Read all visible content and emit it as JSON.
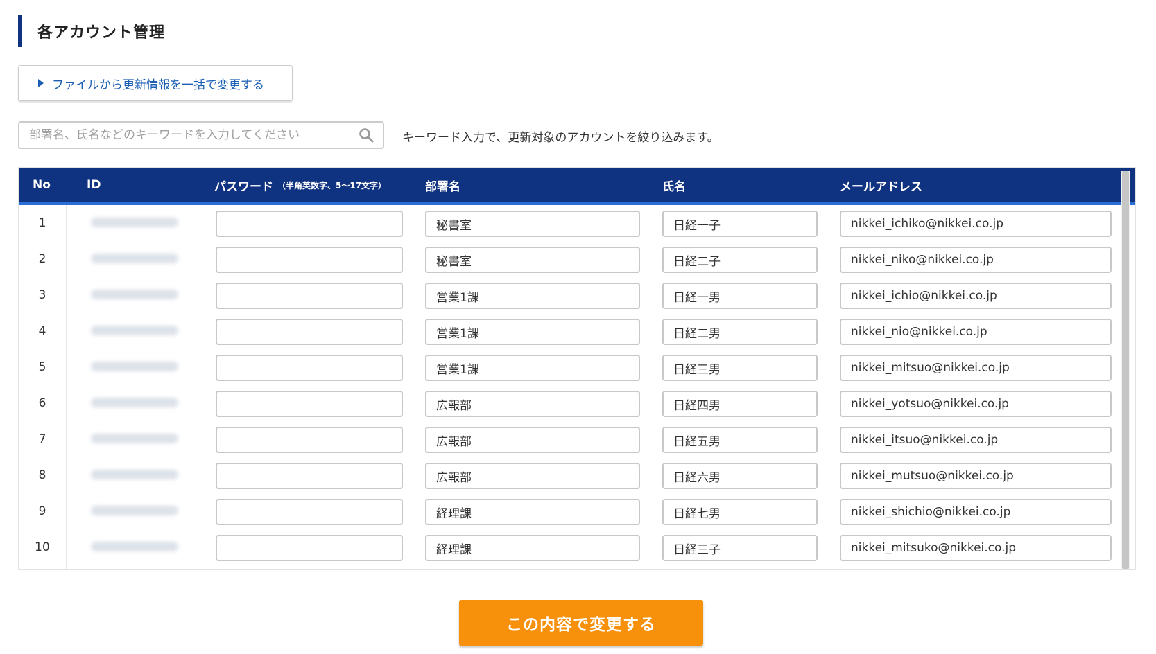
{
  "header": {
    "title": "各アカウント管理",
    "accent_color": "#0f3380"
  },
  "bulk_update": {
    "label": "ファイルから更新情報を一括で変更する",
    "icon": "caret-right-icon",
    "color": "#1a5fb4"
  },
  "search": {
    "placeholder": "部署名、氏名などのキーワードを入力してください",
    "value": "",
    "icon": "search-icon",
    "hint": "キーワード入力で、更新対象のアカウントを絞り込みます。"
  },
  "table": {
    "header_color": "#0f3380",
    "header_underline_color": "#2b6fd6",
    "columns": {
      "no": "No",
      "id": "ID",
      "password": "パスワード",
      "password_note": "（半角英数字、5～17文字）",
      "department": "部署名",
      "name": "氏名",
      "email": "メールアドレス"
    },
    "rows": [
      {
        "no": "1",
        "password": "",
        "department": "秘書室",
        "name": "日経一子",
        "email": "nikkei_ichiko@nikkei.co.jp"
      },
      {
        "no": "2",
        "password": "",
        "department": "秘書室",
        "name": "日経二子",
        "email": "nikkei_niko@nikkei.co.jp"
      },
      {
        "no": "3",
        "password": "",
        "department": "営業1課",
        "name": "日経一男",
        "email": "nikkei_ichio@nikkei.co.jp"
      },
      {
        "no": "4",
        "password": "",
        "department": "営業1課",
        "name": "日経二男",
        "email": "nikkei_nio@nikkei.co.jp"
      },
      {
        "no": "5",
        "password": "",
        "department": "営業1課",
        "name": "日経三男",
        "email": "nikkei_mitsuo@nikkei.co.jp"
      },
      {
        "no": "6",
        "password": "",
        "department": "広報部",
        "name": "日経四男",
        "email": "nikkei_yotsuo@nikkei.co.jp"
      },
      {
        "no": "7",
        "password": "",
        "department": "広報部",
        "name": "日経五男",
        "email": "nikkei_itsuo@nikkei.co.jp"
      },
      {
        "no": "8",
        "password": "",
        "department": "広報部",
        "name": "日経六男",
        "email": "nikkei_mutsuo@nikkei.co.jp"
      },
      {
        "no": "9",
        "password": "",
        "department": "経理課",
        "name": "日経七男",
        "email": "nikkei_shichio@nikkei.co.jp"
      },
      {
        "no": "10",
        "password": "",
        "department": "経理課",
        "name": "日経三子",
        "email": "nikkei_mitsuko@nikkei.co.jp"
      }
    ]
  },
  "submit": {
    "label": "この内容で変更する",
    "color": "#f7900a"
  }
}
